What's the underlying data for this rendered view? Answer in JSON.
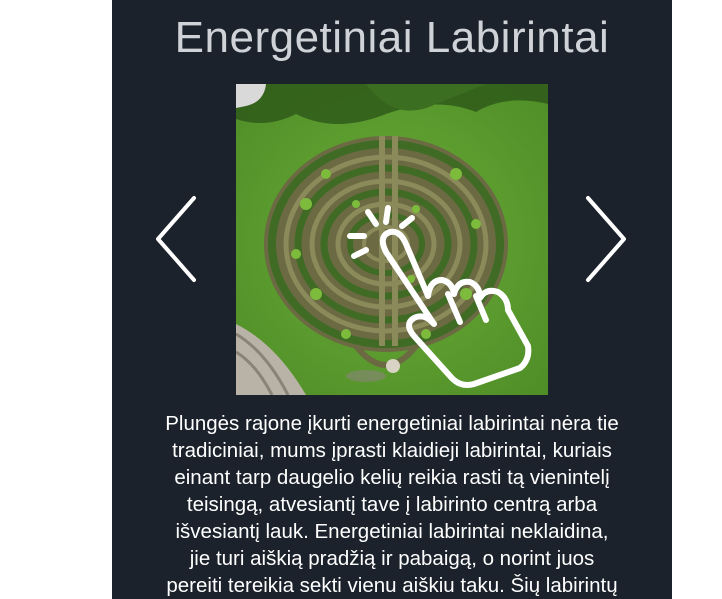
{
  "page": {
    "title": "Energetiniai Labirintai"
  },
  "slider": {
    "prev_icon": "chevron-left-icon",
    "next_icon": "chevron-right-icon",
    "image": "aerial-labyrinth-photo",
    "overlay_icon": "tap-hand-icon"
  },
  "description": {
    "lines": [
      "Plungės rajone įkurti energetiniai labirintai nėra tie",
      "tradiciniai, mums įprasti klaidieji labirintai, kuriais",
      "einant tarp daugelio kelių reikia rasti tą vienintelį",
      "teisingą, atvesiantį tave į labirinto centrą arba",
      "išvesiantį lauk. Energetiniai labirintai neklaidina,",
      "jie turi aiškią pradžią ir pabaigą, o norint juos",
      "pereiti tereikia sekti vienu aiškiu taku. Šių labirintų"
    ]
  },
  "colors": {
    "panel_background": "#1b222b",
    "title_text": "#cfd3d8",
    "body_text": "#ffffff",
    "grass": "#5c9e30"
  }
}
